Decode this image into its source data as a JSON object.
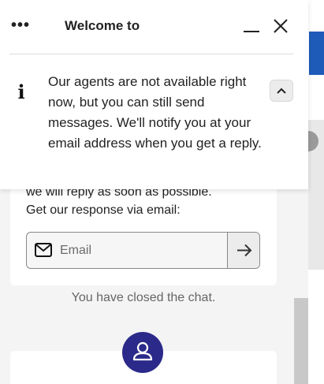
{
  "header": {
    "menu_label": "•••",
    "title": "Welcome to"
  },
  "notice": {
    "text": "Our agents are not available right now, but you can still send messages. We'll notify you at your email address when you get a reply."
  },
  "card": {
    "line1": "we will reply as soon as possible.",
    "line2": "Get our response via email:"
  },
  "email": {
    "placeholder": "Email"
  },
  "status": {
    "closed_text": "You have closed the chat."
  },
  "colors": {
    "accent": "#2b2a8a",
    "brand_blue": "#1e5bb8",
    "link_blue": "#3d63c7"
  }
}
